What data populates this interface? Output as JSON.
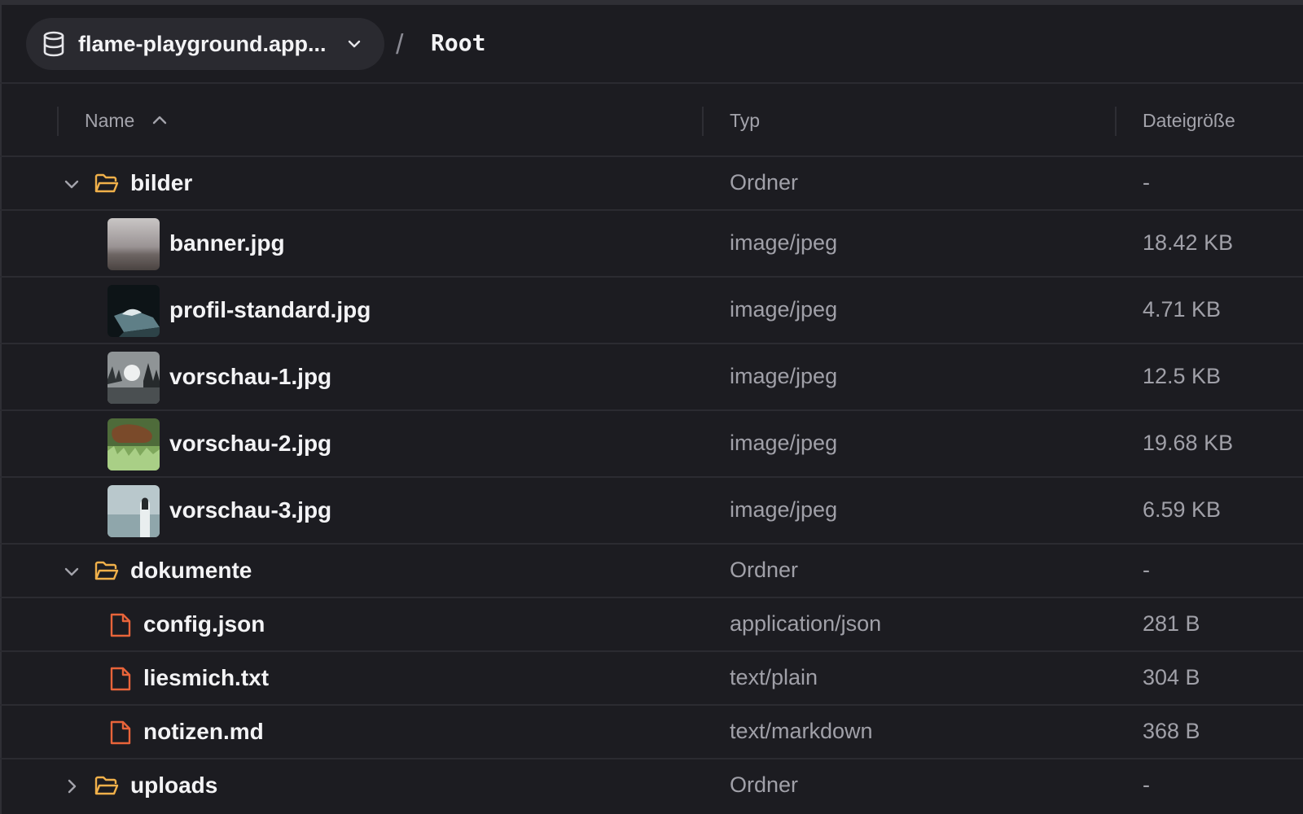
{
  "breadcrumb": {
    "bucket_name": "flame-playground.app...",
    "separator": "/",
    "current": "Root"
  },
  "columns": {
    "name": "Name",
    "type": "Typ",
    "size": "Dateigröße"
  },
  "colors": {
    "background": "#1c1c21",
    "folder_icon": "#f0b04a",
    "file_icon": "#e8643a",
    "secondary_text": "#a0a0a8"
  },
  "rows": [
    {
      "kind": "folder",
      "expanded": true,
      "name": "bilder",
      "type": "Ordner",
      "size": "-"
    },
    {
      "kind": "image",
      "thumb": "banner-thumbnail",
      "name": "banner.jpg",
      "type": "image/jpeg",
      "size": "18.42 KB"
    },
    {
      "kind": "image",
      "thumb": "profile-thumbnail",
      "name": "profil-standard.jpg",
      "type": "image/jpeg",
      "size": "4.71 KB"
    },
    {
      "kind": "image",
      "thumb": "preview1-thumbnail",
      "name": "vorschau-1.jpg",
      "type": "image/jpeg",
      "size": "12.5 KB"
    },
    {
      "kind": "image",
      "thumb": "preview2-thumbnail",
      "name": "vorschau-2.jpg",
      "type": "image/jpeg",
      "size": "19.68 KB"
    },
    {
      "kind": "image",
      "thumb": "preview3-thumbnail",
      "name": "vorschau-3.jpg",
      "type": "image/jpeg",
      "size": "6.59 KB"
    },
    {
      "kind": "folder",
      "expanded": true,
      "name": "dokumente",
      "type": "Ordner",
      "size": "-"
    },
    {
      "kind": "doc",
      "name": "config.json",
      "type": "application/json",
      "size": "281 B"
    },
    {
      "kind": "doc",
      "name": "liesmich.txt",
      "type": "text/plain",
      "size": "304 B"
    },
    {
      "kind": "doc",
      "name": "notizen.md",
      "type": "text/markdown",
      "size": "368 B"
    },
    {
      "kind": "folder",
      "expanded": false,
      "name": "uploads",
      "type": "Ordner",
      "size": "-"
    }
  ]
}
